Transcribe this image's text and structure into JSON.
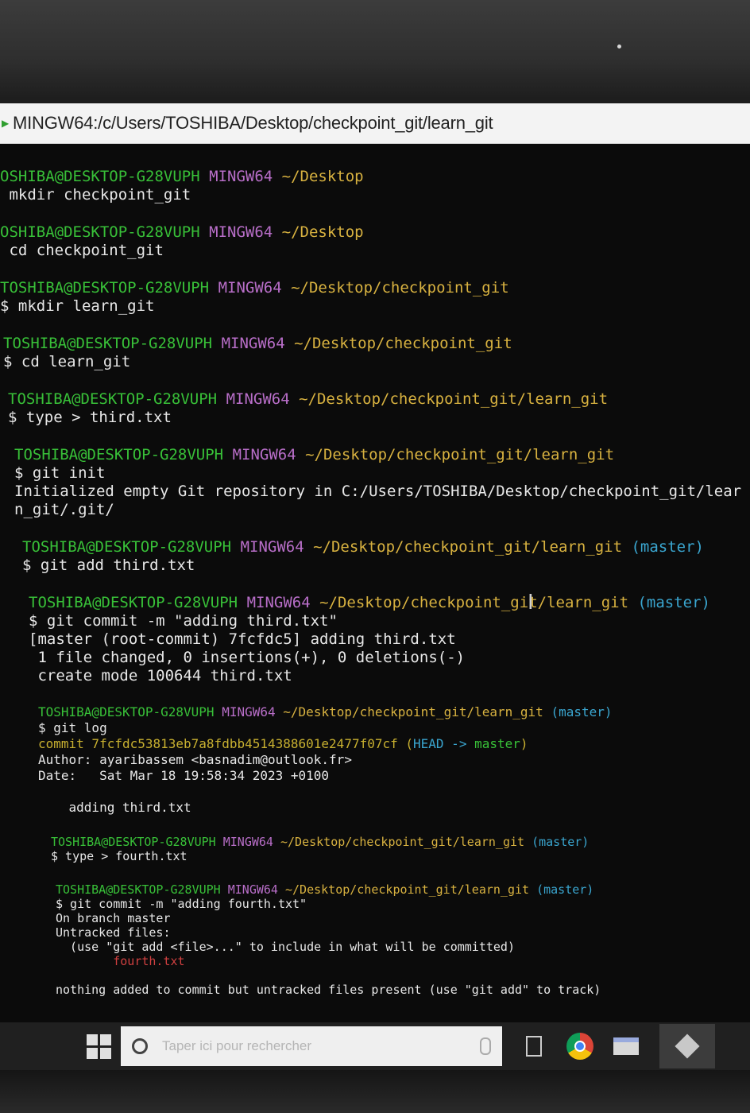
{
  "window": {
    "title": "MINGW64:/c/Users/TOSHIBA/Desktop/checkpoint_git/learn_git"
  },
  "terminal": {
    "blocks": [
      {
        "user": "OSHIBA@DESKTOP-G28VUPH",
        "env": "MINGW64",
        "path": "~/Desktop",
        "branch": "",
        "cmd": " mkdir checkpoint_git",
        "output": []
      },
      {
        "user": "OSHIBA@DESKTOP-G28VUPH",
        "env": "MINGW64",
        "path": "~/Desktop",
        "branch": "",
        "cmd": " cd checkpoint_git",
        "output": []
      },
      {
        "user": "TOSHIBA@DESKTOP-G28VUPH",
        "env": "MINGW64",
        "path": "~/Desktop/checkpoint_git",
        "branch": "",
        "cmd": "$ mkdir learn_git",
        "output": []
      },
      {
        "user": "TOSHIBA@DESKTOP-G28VUPH",
        "env": "MINGW64",
        "path": "~/Desktop/checkpoint_git",
        "branch": "",
        "cmd": "$ cd learn_git",
        "output": []
      },
      {
        "user": "TOSHIBA@DESKTOP-G28VUPH",
        "env": "MINGW64",
        "path": "~/Desktop/checkpoint_git/learn_git",
        "branch": "",
        "cmd": "$ type > third.txt",
        "output": []
      },
      {
        "user": "TOSHIBA@DESKTOP-G28VUPH",
        "env": "MINGW64",
        "path": "~/Desktop/checkpoint_git/learn_git",
        "branch": "",
        "cmd": "$ git init",
        "output": [
          "Initialized empty Git repository in C:/Users/TOSHIBA/Desktop/checkpoint_git/lear",
          "n_git/.git/"
        ]
      },
      {
        "user": "TOSHIBA@DESKTOP-G28VUPH",
        "env": "MINGW64",
        "path": "~/Desktop/checkpoint_git/learn_git",
        "branch": "(master)",
        "cmd": "$ git add third.txt",
        "output": []
      },
      {
        "user": "TOSHIBA@DESKTOP-G28VUPH",
        "env": "MINGW64",
        "path": "~/Desktop/checkpoint_git/learn_git",
        "branch": "(master)",
        "cmd": "$ git commit -m \"adding third.txt\"",
        "output": [
          "[master (root-commit) 7fcfdc5] adding third.txt",
          " 1 file changed, 0 insertions(+), 0 deletions(-)",
          " create mode 100644 third.txt"
        ]
      }
    ],
    "log_block": {
      "user": "TOSHIBA@DESKTOP-G28VUPH",
      "env": "MINGW64",
      "path": "~/Desktop/checkpoint_git/learn_git",
      "branch": "(master)",
      "cmd": "$ git log",
      "commit_label": "commit 7fcfdc53813eb7a8fdbb4514388601e2477f07cf",
      "commit_ref_open": " (",
      "commit_head": "HEAD -> ",
      "commit_master": "master",
      "commit_ref_close": ")",
      "author": "Author: ayaribassem <basnadim@outlook.fr>",
      "date": "Date:   Sat Mar 18 19:58:34 2023 +0100",
      "message": "    adding third.txt"
    },
    "fourth_block": {
      "user": "TOSHIBA@DESKTOP-G28VUPH",
      "env": "MINGW64",
      "path": "~/Desktop/checkpoint_git/learn_git",
      "branch": "(master)",
      "cmd": "$ type > fourth.txt"
    },
    "commit2_block": {
      "user": "TOSHIBA@DESKTOP-G28VUPH",
      "env": "MINGW64",
      "path": "~/Desktop/checkpoint_git/learn_git",
      "branch": "(master)",
      "cmd": "$ git commit -m \"adding fourth.txt\"",
      "on_branch": "On branch master",
      "untracked": "Untracked files:",
      "hint": "  (use \"git add <file>...\" to include in what will be committed)",
      "file": "        fourth.txt",
      "nothing": "nothing added to commit but untracked files present (use \"git add\" to track)"
    }
  },
  "taskbar": {
    "search_placeholder": "Taper ici pour rechercher",
    "icons": [
      "windows-start-icon",
      "search-icon",
      "microphone-icon",
      "task-view-icon",
      "chrome-icon",
      "file-explorer-icon",
      "git-bash-icon"
    ]
  },
  "colors": {
    "prompt_user": "#38c038",
    "prompt_env": "#b86ec8",
    "prompt_path": "#d8b240",
    "prompt_branch": "#3aa6d0",
    "untracked_file": "#d04040",
    "commit_hash": "#c8b030"
  }
}
